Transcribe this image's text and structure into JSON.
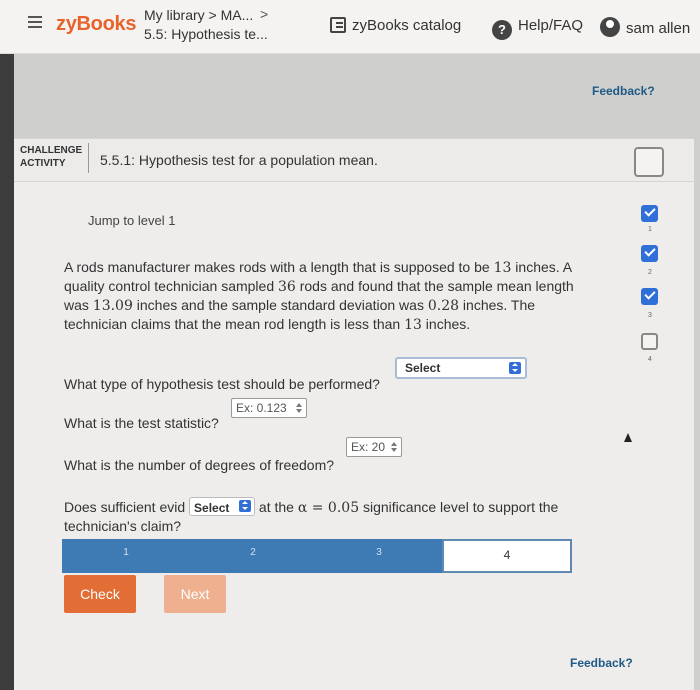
{
  "nav": {
    "logo": "zyBooks",
    "breadcrumb_line1": "My library > MA...",
    "breadcrumb_line2": "5.5: Hypothesis te...",
    "breadcrumb_arrow": ">",
    "catalog": "zyBooks catalog",
    "help": "Help/FAQ",
    "help_icon_glyph": "?",
    "user": "sam allen"
  },
  "feedback_top": "Feedback?",
  "challenge": {
    "label_line1": "CHALLENGE",
    "label_line2": "ACTIVITY",
    "title": "5.5.1: Hypothesis test for a population mean."
  },
  "jump": "Jump to level 1",
  "problem": {
    "p1": "A rods manufacturer makes rods with a length that is supposed to be ",
    "v1": "13",
    "p2": " inches. A quality control technician sampled ",
    "v2": "36",
    "p3": " rods and found that the sample mean length was ",
    "v3": "13.09",
    "p4": " inches and the sample standard deviation was ",
    "v4": "0.28",
    "p5": " inches. The technician claims that the mean rod length is less than ",
    "v5": "13",
    "p6": " inches."
  },
  "q1": {
    "text": "What type of hypothesis test should be performed?",
    "select_value": "Select"
  },
  "q2": {
    "text": "What is the test statistic?",
    "placeholder": "Ex: 0.123"
  },
  "q3": {
    "text": "What is the number of degrees of freedom?",
    "placeholder": "Ex: 20"
  },
  "q4": {
    "text_a": "Does sufficient evid",
    "select_value": "Select",
    "text_b": " at the ",
    "alpha_expr": "α = 0.05",
    "text_c": " significance level to support the technician's claim?"
  },
  "progress": {
    "levels": [
      "1",
      "2",
      "3",
      "4"
    ],
    "current": 4
  },
  "buttons": {
    "check": "Check",
    "next": "Next"
  },
  "feedback_bottom": "Feedback?",
  "level_indicators": [
    {
      "num": "1",
      "state": "done"
    },
    {
      "num": "2",
      "state": "done"
    },
    {
      "num": "3",
      "state": "done"
    },
    {
      "num": "4",
      "state": "open"
    }
  ],
  "colors": {
    "brand": "#e8632b",
    "accent_blue": "#2f6fd6",
    "progress_blue": "#3e7bb5",
    "check_button": "#e26d35",
    "link": "#1e5a85"
  }
}
